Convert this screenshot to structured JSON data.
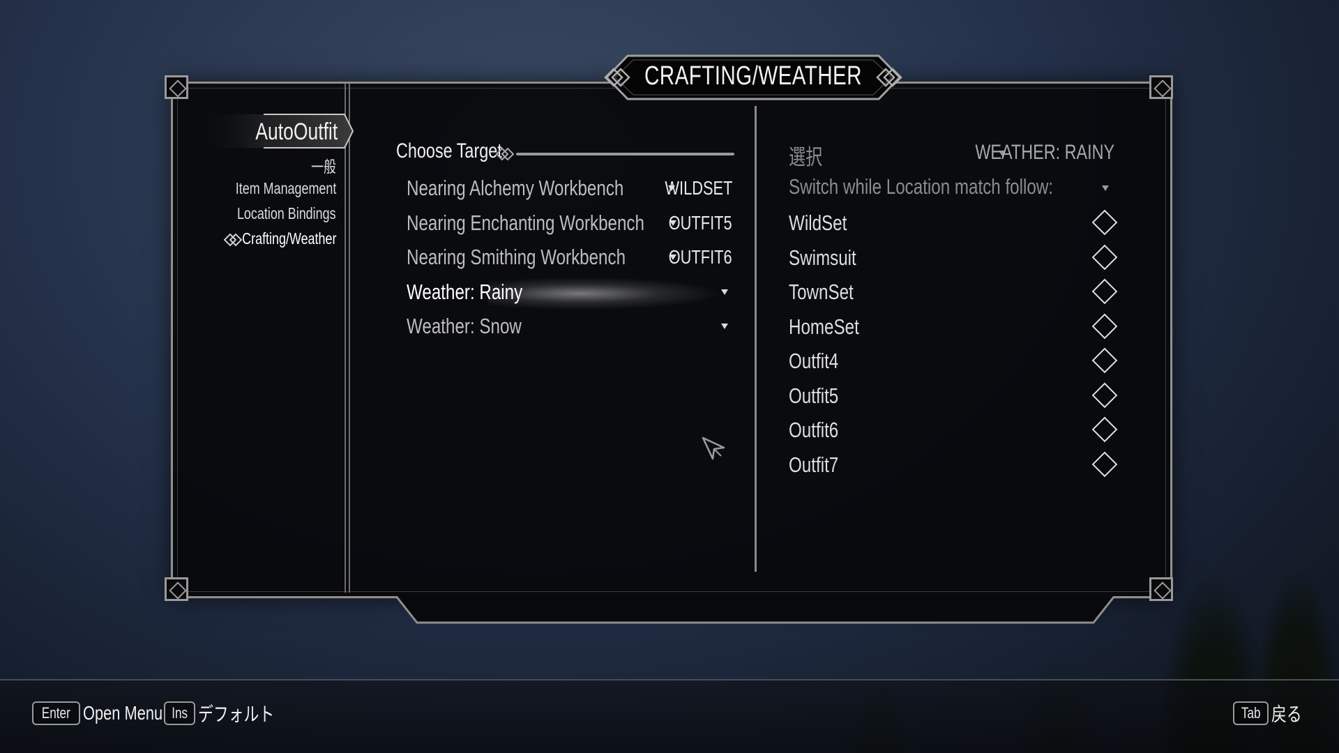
{
  "title": "CRAFTING/WEATHER",
  "sidebar": {
    "mod_name": "AutoOutfit",
    "items": [
      {
        "label": "一般"
      },
      {
        "label": "Item Management"
      },
      {
        "label": "Location Bindings"
      },
      {
        "label": "Crafting/Weather",
        "active": true
      }
    ]
  },
  "left_column": {
    "header": "Choose Target",
    "options": [
      {
        "label": "Nearing Alchemy Workbench",
        "value": "WILDSET"
      },
      {
        "label": "Nearing Enchanting Workbench",
        "value": "OUTFIT5"
      },
      {
        "label": "Nearing Smithing Workbench",
        "value": "OUTFIT6"
      },
      {
        "label": "Weather: Rainy",
        "value": "",
        "highlighted": true
      },
      {
        "label": "Weather: Snow",
        "value": ""
      }
    ]
  },
  "right_column": {
    "select_label": "選択",
    "select_value": "WEATHER: RAINY",
    "switch_label": "Switch while Location match follow:",
    "outfits": [
      {
        "label": "WildSet",
        "checked": false
      },
      {
        "label": "Swimsuit",
        "checked": false
      },
      {
        "label": "TownSet",
        "checked": false
      },
      {
        "label": "HomeSet",
        "checked": false
      },
      {
        "label": "Outfit4",
        "checked": false
      },
      {
        "label": "Outfit5",
        "checked": false
      },
      {
        "label": "Outfit6",
        "checked": false
      },
      {
        "label": "Outfit7",
        "checked": false
      }
    ]
  },
  "bottom_bar": {
    "hints": [
      {
        "key": "Enter",
        "label": "Open Menu"
      },
      {
        "key": "Ins",
        "label": "デフォルト"
      },
      {
        "key": "Tab",
        "label": "戻る"
      }
    ]
  },
  "colors": {
    "panel_bg": "#08090c",
    "border": "#8e8e8e",
    "text_primary": "#f0f0f0",
    "text_dim": "#8c8c8c"
  }
}
